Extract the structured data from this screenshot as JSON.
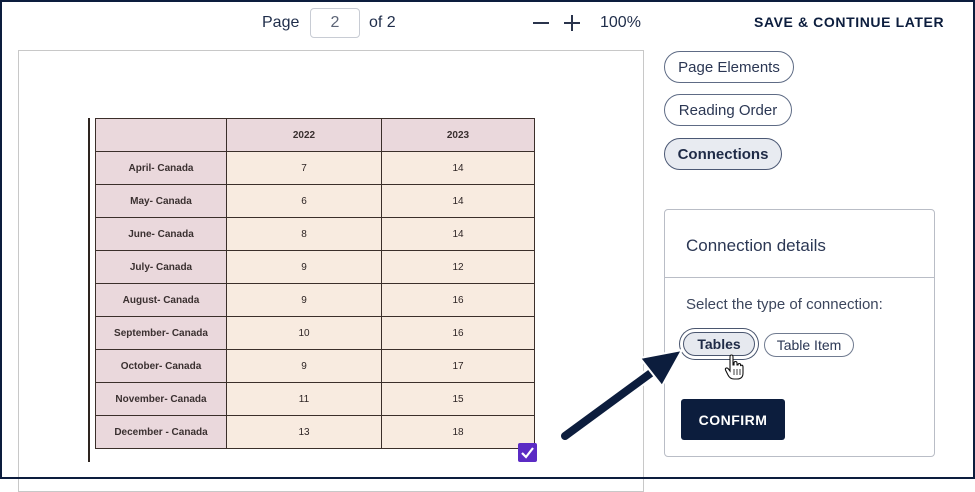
{
  "toolbar": {
    "page_label": "Page",
    "page_value": "2",
    "of_label": "of 2",
    "zoom_level": "100%",
    "save_label": "SAVE & CONTINUE LATER"
  },
  "document": {
    "table": {
      "headers": [
        "",
        "2022",
        "2023"
      ],
      "rows": [
        [
          "April- Canada",
          "7",
          "14"
        ],
        [
          "May- Canada",
          "6",
          "14"
        ],
        [
          "June- Canada",
          "8",
          "14"
        ],
        [
          "July- Canada",
          "9",
          "12"
        ],
        [
          "August- Canada",
          "9",
          "16"
        ],
        [
          "September- Canada",
          "10",
          "16"
        ],
        [
          "October- Canada",
          "9",
          "17"
        ],
        [
          "November- Canada",
          "11",
          "15"
        ],
        [
          "December - Canada",
          "13",
          "18"
        ]
      ]
    },
    "check_icon": "checkbox-checked-icon"
  },
  "side_panel": {
    "buttons": {
      "page_elements": "Page Elements",
      "reading_order": "Reading Order",
      "connections": "Connections"
    },
    "details": {
      "title": "Connection details",
      "prompt": "Select the type of connection:",
      "option_tables": "Tables",
      "option_table_item": "Table Item",
      "confirm": "CONFIRM"
    }
  },
  "colors": {
    "navy": "#0c1d3d",
    "table_header_fill": "#ead8dc",
    "table_cell_fill": "#f8ebe0",
    "checkbox": "#5b2bc4"
  }
}
